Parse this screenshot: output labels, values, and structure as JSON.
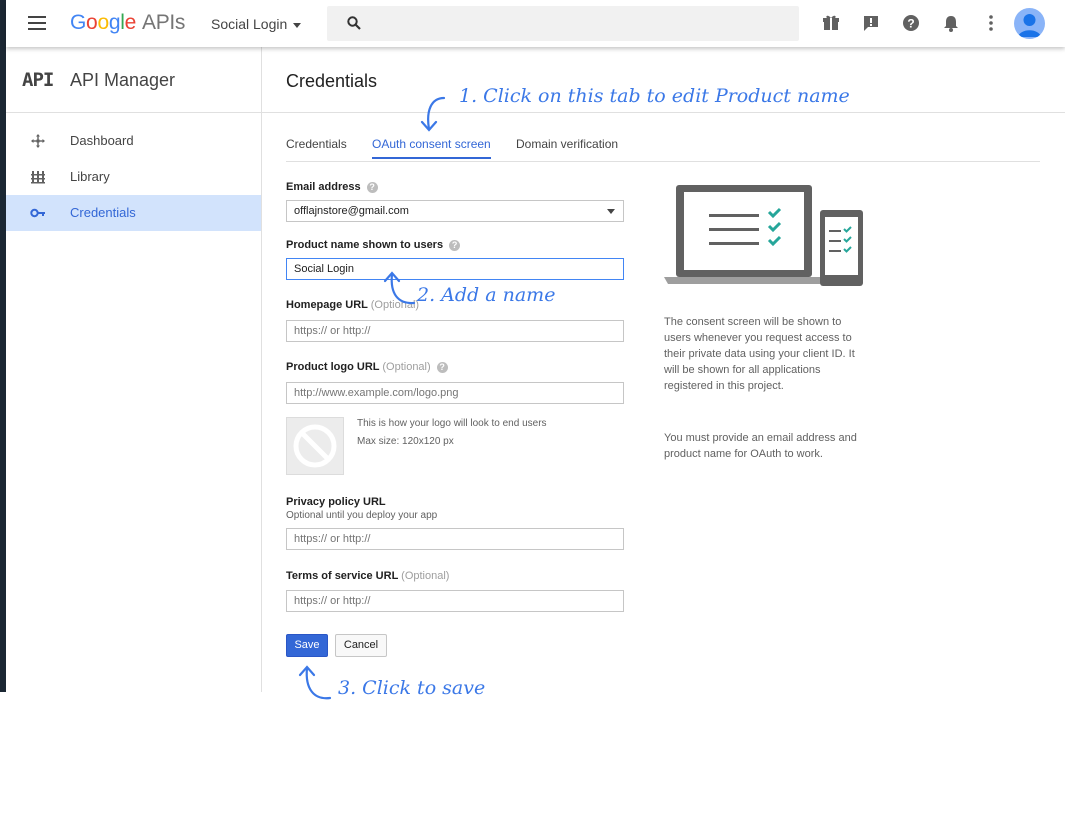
{
  "topbar": {
    "logo_letters": [
      "G",
      "o",
      "o",
      "g",
      "l",
      "e"
    ],
    "logo_suffix": "APIs",
    "project": "Social Login",
    "icons": [
      "menu-icon",
      "search-icon",
      "gift-icon",
      "feedback-icon",
      "help-icon",
      "notifications-icon",
      "more-vert-icon",
      "account-avatar"
    ]
  },
  "sidebar": {
    "mark": "API",
    "title": "API Manager",
    "items": [
      {
        "label": "Dashboard",
        "icon": "dashboard-icon"
      },
      {
        "label": "Library",
        "icon": "library-icon"
      },
      {
        "label": "Credentials",
        "icon": "key-icon",
        "active": true
      }
    ]
  },
  "main": {
    "title": "Credentials",
    "tabs": [
      {
        "label": "Credentials"
      },
      {
        "label": "OAuth consent screen",
        "active": true
      },
      {
        "label": "Domain verification"
      }
    ]
  },
  "form": {
    "email_label": "Email address",
    "email_value": "offlajnstore@gmail.com",
    "product_label": "Product name shown to users",
    "product_value": "Social Login",
    "homepage_label": "Homepage URL",
    "homepage_opt": "(Optional)",
    "homepage_placeholder": "https:// or http://",
    "logo_label": "Product logo URL",
    "logo_opt": "(Optional)",
    "logo_placeholder": "http://www.example.com/logo.png",
    "logo_note_1": "This is how your logo will look to end users",
    "logo_note_2": "Max size: 120x120 px",
    "privacy_label": "Privacy policy URL",
    "privacy_sub": "Optional until you deploy your app",
    "privacy_placeholder": "https:// or http://",
    "tos_label": "Terms of service URL",
    "tos_opt": "(Optional)",
    "tos_placeholder": "https:// or http://",
    "save": "Save",
    "cancel": "Cancel"
  },
  "info": {
    "p1": "The consent screen will be shown to users whenever you request access to their private data using your client ID. It will be shown for all applications registered in this project.",
    "p2": "You must provide an email address and product name for OAuth to work."
  },
  "annotations": {
    "a1": "1. Click on this tab to edit Product name",
    "a2": "2. Add a name",
    "a3": "3. Click to save"
  },
  "colors": {
    "accent": "#3367d6",
    "annotation": "#3b78e7",
    "check": "#26a69a"
  }
}
